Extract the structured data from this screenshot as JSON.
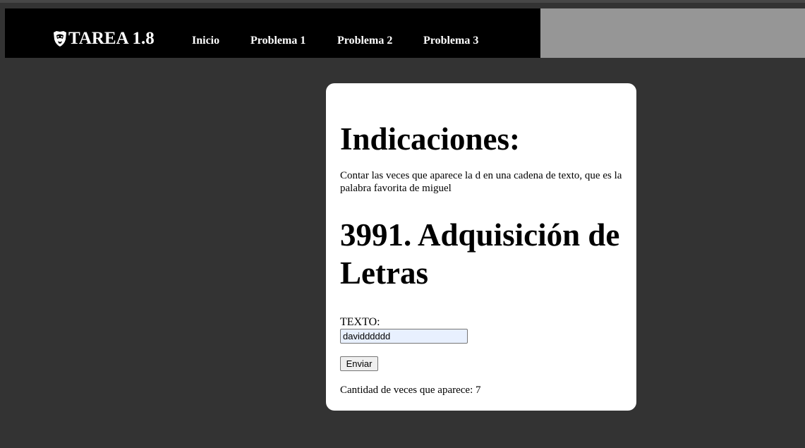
{
  "navbar": {
    "brand_icon": "lion-shield-icon",
    "brand": "TAREA 1.8",
    "links": [
      "Inicio",
      "Problema 1",
      "Problema 2",
      "Problema 3"
    ]
  },
  "card": {
    "heading": "Indicaciones:",
    "description": "Contar las veces que aparece la d en una cadena de texto, que es la palabra favorita de miguel",
    "problem_title": "3991. Adquisición de Letras",
    "form": {
      "label": "TEXTO:",
      "input_value": "davidddddd",
      "submit_label": "Enviar"
    },
    "result": "Cantidad de veces que aparece: 7"
  }
}
